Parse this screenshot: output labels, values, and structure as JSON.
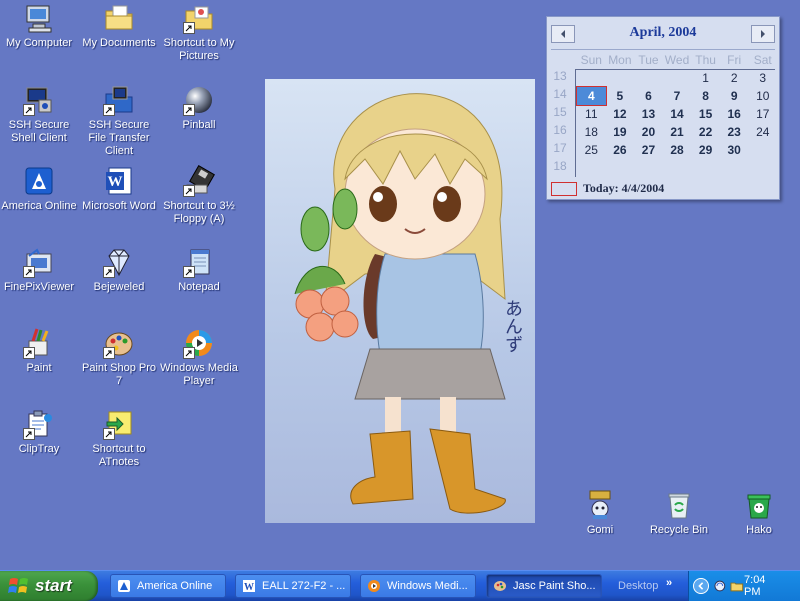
{
  "desktop_icons": [
    {
      "label": "My Computer",
      "icon": "my-computer-icon",
      "shortcut": false
    },
    {
      "label": "My Documents",
      "icon": "my-documents-icon",
      "shortcut": false
    },
    {
      "label": "Shortcut to My Pictures",
      "icon": "my-pictures-icon",
      "shortcut": true
    },
    {
      "label": "SSH Secure Shell Client",
      "icon": "ssh-shell-icon",
      "shortcut": true
    },
    {
      "label": "SSH Secure File Transfer Client",
      "icon": "ssh-file-transfer-icon",
      "shortcut": true
    },
    {
      "label": "Pinball",
      "icon": "pinball-icon",
      "shortcut": true
    },
    {
      "label": "America Online",
      "icon": "aol-icon",
      "shortcut": false
    },
    {
      "label": "Microsoft Word",
      "icon": "word-icon",
      "shortcut": false
    },
    {
      "label": "Shortcut to 3½ Floppy (A)",
      "icon": "floppy-icon",
      "shortcut": true
    },
    {
      "label": "FinePixViewer",
      "icon": "finepix-icon",
      "shortcut": true
    },
    {
      "label": "Bejeweled",
      "icon": "bejeweled-icon",
      "shortcut": true
    },
    {
      "label": "Notepad",
      "icon": "notepad-icon",
      "shortcut": true
    },
    {
      "label": "Paint",
      "icon": "paint-icon",
      "shortcut": true
    },
    {
      "label": "Paint Shop Pro 7",
      "icon": "paint-shop-pro-icon",
      "shortcut": true
    },
    {
      "label": "Windows Media Player",
      "icon": "media-player-icon",
      "shortcut": true
    },
    {
      "label": "ClipTray",
      "icon": "cliptray-icon",
      "shortcut": true
    },
    {
      "label": "Shortcut to ATnotes",
      "icon": "atnotes-icon",
      "shortcut": true
    },
    {
      "label": "Gomi",
      "icon": "gomi-icon",
      "shortcut": false
    },
    {
      "label": "Recycle Bin",
      "icon": "recycle-bin-icon",
      "shortcut": false
    },
    {
      "label": "Hako",
      "icon": "hako-icon",
      "shortcut": false
    }
  ],
  "wallpaper": {
    "caption": "あんず"
  },
  "calendar": {
    "title": "April, 2004",
    "prev_icon": "chevron-left-icon",
    "next_icon": "chevron-right-icon",
    "weekdays": [
      "Sun",
      "Mon",
      "Tue",
      "Wed",
      "Thu",
      "Fri",
      "Sat"
    ],
    "week_numbers": [
      "13",
      "14",
      "15",
      "16",
      "17",
      "18"
    ],
    "weeks": [
      [
        "",
        "",
        "",
        "",
        "1",
        "2",
        "3"
      ],
      [
        "4",
        "5",
        "6",
        "7",
        "8",
        "9",
        "10"
      ],
      [
        "11",
        "12",
        "13",
        "14",
        "15",
        "16",
        "17"
      ],
      [
        "18",
        "19",
        "20",
        "21",
        "22",
        "23",
        "24"
      ],
      [
        "25",
        "26",
        "27",
        "28",
        "29",
        "30",
        ""
      ]
    ],
    "bold_days": [
      "5",
      "6",
      "7",
      "8",
      "9",
      "12",
      "13",
      "14",
      "15",
      "16",
      "19",
      "20",
      "21",
      "22",
      "23",
      "26",
      "27",
      "28",
      "29",
      "30"
    ],
    "selected_day": "4",
    "today_label": "Today: 4/4/2004"
  },
  "taskbar": {
    "start_label": "start",
    "tasks": [
      {
        "label": "America  Online",
        "icon": "aol-icon",
        "active": false
      },
      {
        "label": "EALL 272-F2 - ...",
        "icon": "word-icon",
        "active": false
      },
      {
        "label": "Windows Medi...",
        "icon": "media-player-icon",
        "active": false
      },
      {
        "label": "Jasc Paint Sho...",
        "icon": "paint-shop-pro-icon",
        "active": true
      }
    ],
    "desktop_toolbar_label": "Desktop",
    "chevrons": "»",
    "clock": "7:04 PM"
  },
  "colors": {
    "desktop_bg": "#6578c4",
    "taskbar_blue": "#245edb",
    "start_green": "#3a913a",
    "tray_blue": "#1279d6",
    "calendar_title": "#1c3a9a",
    "today_marker": "#d03030"
  }
}
